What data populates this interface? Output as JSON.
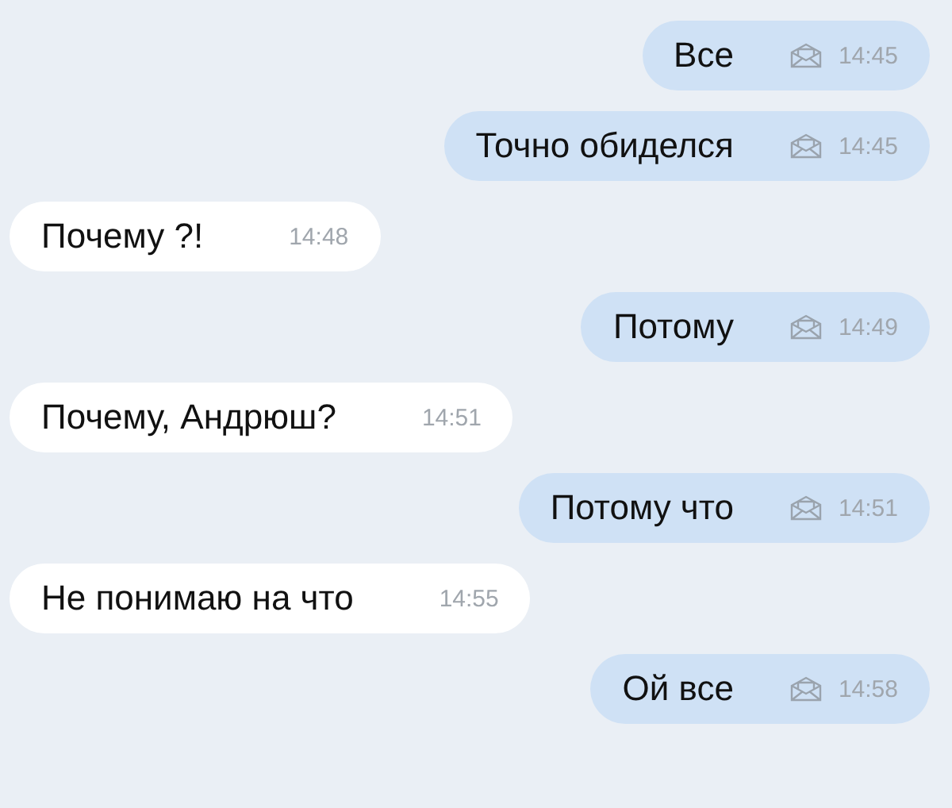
{
  "messages": [
    {
      "kind": "outgoing",
      "text": "Все",
      "time": "14:45"
    },
    {
      "kind": "outgoing",
      "text": "Точно обиделся",
      "time": "14:45"
    },
    {
      "kind": "incoming",
      "text": "Почему ?!",
      "time": "14:48"
    },
    {
      "kind": "outgoing",
      "text": "Потому",
      "time": "14:49"
    },
    {
      "kind": "incoming",
      "text": "Почему, Андрюш?",
      "time": "14:51"
    },
    {
      "kind": "outgoing",
      "text": "Потому что",
      "time": "14:51"
    },
    {
      "kind": "incoming",
      "text": "Не понимаю на что",
      "time": "14:55"
    },
    {
      "kind": "outgoing",
      "text": "Ой все",
      "time": "14:58"
    }
  ]
}
